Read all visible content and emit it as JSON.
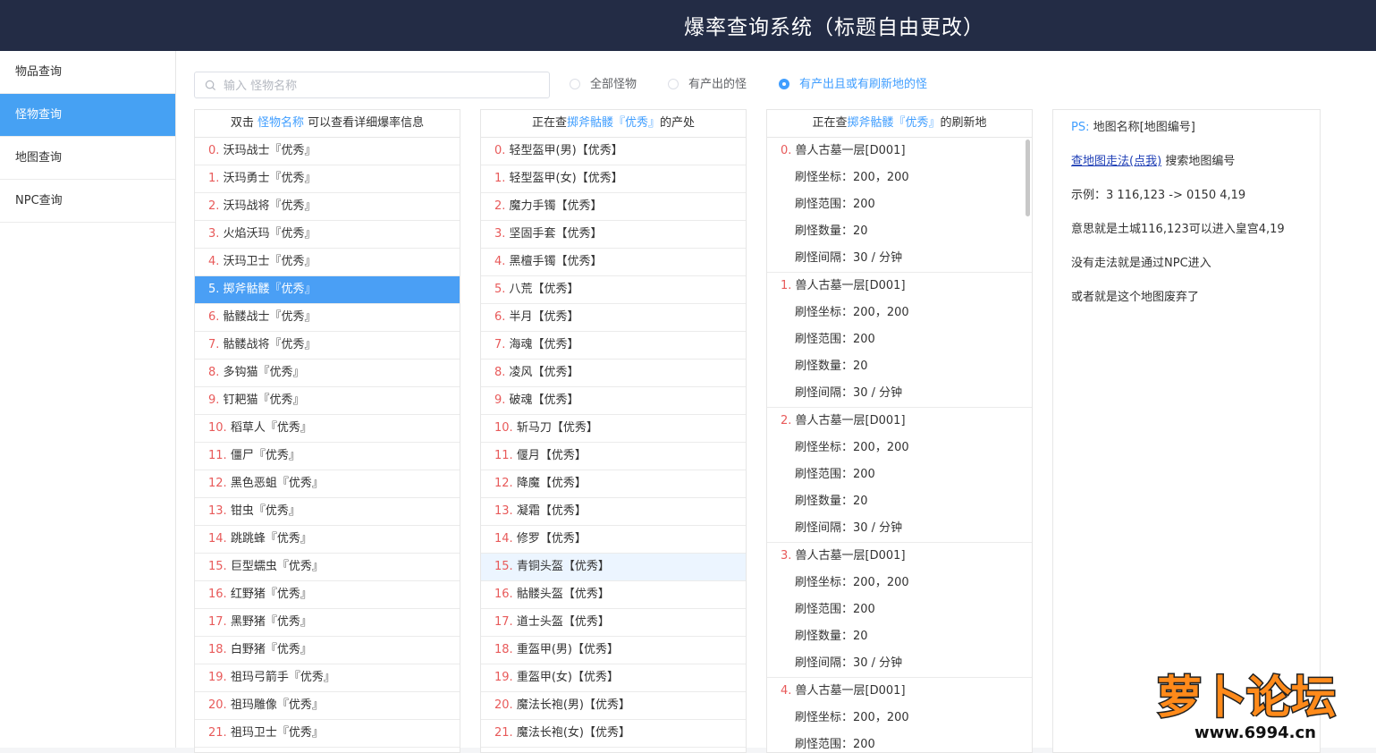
{
  "header": {
    "title": "爆率查询系统（标题自由更改）"
  },
  "sidebar": {
    "items": [
      {
        "label": "物品查询",
        "active": false
      },
      {
        "label": "怪物查询",
        "active": true
      },
      {
        "label": "地图查询",
        "active": false
      },
      {
        "label": "NPC查询",
        "active": false
      }
    ]
  },
  "search": {
    "placeholder": "输入 怪物名称",
    "value": ""
  },
  "filters": [
    {
      "label": "全部怪物",
      "checked": false
    },
    {
      "label": "有产出的怪",
      "checked": false
    },
    {
      "label": "有产出且或有刷新地的怪",
      "checked": true
    }
  ],
  "monster_panel": {
    "head_pre": "双击",
    "head_hl": "怪物名称",
    "head_post": "可以查看详细爆率信息",
    "selected_index": 5,
    "items": [
      "沃玛战士『优秀』",
      "沃玛勇士『优秀』",
      "沃玛战将『优秀』",
      "火焰沃玛『优秀』",
      "沃玛卫士『优秀』",
      "掷斧骷髅『优秀』",
      "骷髅战士『优秀』",
      "骷髅战将『优秀』",
      "多钩猫『优秀』",
      "钉耙猫『优秀』",
      "稻草人『优秀』",
      "僵尸『优秀』",
      "黑色恶蛆『优秀』",
      "钳虫『优秀』",
      "跳跳蜂『优秀』",
      "巨型蠕虫『优秀』",
      "红野猪『优秀』",
      "黑野猪『优秀』",
      "白野猪『优秀』",
      "祖玛弓箭手『优秀』",
      "祖玛雕像『优秀』",
      "祖玛卫士『优秀』"
    ]
  },
  "drop_panel": {
    "head_pre": "正在查",
    "head_hl": "掷斧骷髅『优秀』",
    "head_post": "的产处",
    "hover_index": 15,
    "items": [
      "轻型盔甲(男)【优秀】",
      "轻型盔甲(女)【优秀】",
      "魔力手镯【优秀】",
      "坚固手套【优秀】",
      "黑檀手镯【优秀】",
      "八荒【优秀】",
      "半月【优秀】",
      "海魂【优秀】",
      "凌风【优秀】",
      "破魂【优秀】",
      "斩马刀【优秀】",
      "偃月【优秀】",
      "降魔【优秀】",
      "凝霜【优秀】",
      "修罗【优秀】",
      "青铜头盔【优秀】",
      "骷髅头盔【优秀】",
      "道士头盔【优秀】",
      "重盔甲(男)【优秀】",
      "重盔甲(女)【优秀】",
      "魔法长袍(男)【优秀】",
      "魔法长袍(女)【优秀】"
    ]
  },
  "spawn_panel": {
    "head_pre": "正在查",
    "head_hl": "掷斧骷髅『优秀』",
    "head_post": "的刷新地",
    "groups": [
      {
        "map": "兽人古墓一层[D001]",
        "coord": "刷怪坐标：200，200",
        "range": "刷怪范围：200",
        "count": "刷怪数量：20",
        "interval": "刷怪间隔：30 / 分钟"
      },
      {
        "map": "兽人古墓一层[D001]",
        "coord": "刷怪坐标：200，200",
        "range": "刷怪范围：200",
        "count": "刷怪数量：20",
        "interval": "刷怪间隔：30 / 分钟"
      },
      {
        "map": "兽人古墓一层[D001]",
        "coord": "刷怪坐标：200，200",
        "range": "刷怪范围：200",
        "count": "刷怪数量：20",
        "interval": "刷怪间隔：30 / 分钟"
      },
      {
        "map": "兽人古墓一层[D001]",
        "coord": "刷怪坐标：200，200",
        "range": "刷怪范围：200",
        "count": "刷怪数量：20",
        "interval": "刷怪间隔：30 / 分钟"
      },
      {
        "map": "兽人古墓一层[D001]",
        "coord": "刷怪坐标：200，200",
        "range": "刷怪范围：200",
        "count": "",
        "interval": ""
      }
    ]
  },
  "info_panel": {
    "ps_label": "PS:",
    "ps_text": "地图名称[地图编号]",
    "link_pre": "查地图走法",
    "link_click": "(点我)",
    "link_post": "搜索地图编号",
    "example": "示例：3 116,123 -> 0150 4,19",
    "meaning": "意思就是土城116,123可以进入皇宫4,19",
    "no_path": "没有走法就是通过NPC进入",
    "abandoned": "或者就是这个地图废弃了"
  },
  "watermark": {
    "brand": "萝卜论坛",
    "url": "www.6994.cn"
  },
  "colors": {
    "header_bg": "#232c45",
    "accent": "#409eff",
    "index_red": "#e85a5a",
    "selected_row": "#4a9ff5"
  }
}
